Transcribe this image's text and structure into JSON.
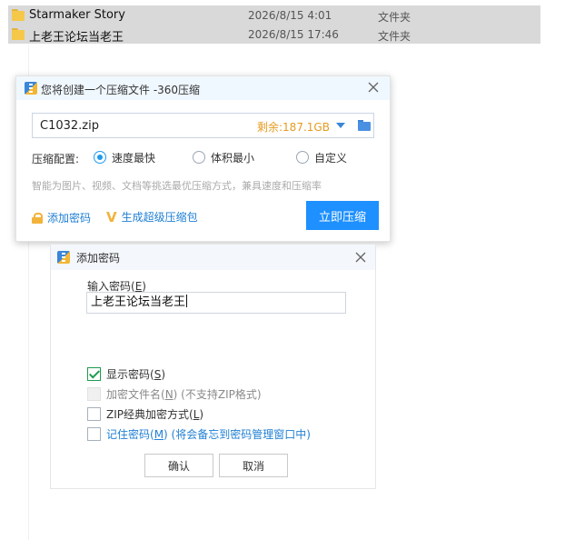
{
  "explorer": {
    "files": [
      {
        "name": "Starmaker Story",
        "date": "2026/8/15 4:01",
        "type": "文件夹"
      },
      {
        "name": "上老王论坛当老王",
        "date": "2026/8/15 17:46",
        "type": "文件夹"
      }
    ]
  },
  "compress_dialog": {
    "title": "您将创建一个压缩文件 -360压缩",
    "filename": "C1032.zip",
    "free_space": "剩余:187.1GB",
    "config_label": "压缩配置:",
    "options": [
      {
        "label": "速度最快",
        "selected": true
      },
      {
        "label": "体积最小",
        "selected": false
      },
      {
        "label": "自定义",
        "selected": false
      }
    ],
    "hint": "智能为图片、视频、文档等挑选最优压缩方式，兼具速度和压缩率",
    "add_password_link": "添加密码",
    "super_package_link": "生成超级压缩包",
    "compress_button": "立即压缩",
    "accent_color": "#1e90ff"
  },
  "password_dialog": {
    "title": "添加密码",
    "input_label": "输入密码(",
    "input_label_key": "E",
    "input_label_end": ")",
    "password_value": "上老王论坛当老王",
    "show_password": {
      "label": "显示密码(",
      "key": "S",
      "end": ")",
      "checked": true
    },
    "encrypt_filenames": {
      "label": "加密文件名(",
      "key": "N",
      "end": ") (不支持ZIP格式)",
      "checked": false,
      "disabled": true
    },
    "zip_classic": {
      "label": "ZIP经典加密方式(",
      "key": "L",
      "end": ")",
      "checked": false
    },
    "remember_password": {
      "label": "记住密码(",
      "key": "M",
      "end": ") (将会备忘到密码管理窗口中)",
      "checked": false
    },
    "ok_button": "确认",
    "cancel_button": "取消"
  }
}
